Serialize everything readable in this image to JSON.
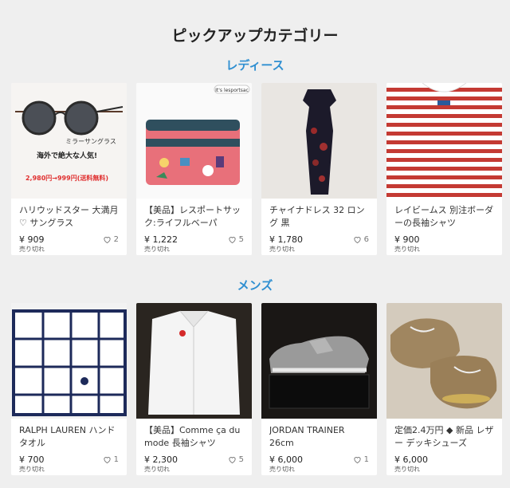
{
  "page_title": "ピックアップカテゴリー",
  "sections": [
    {
      "heading": "レディース",
      "items": [
        {
          "title": "ハリウッドスター 大満月 ♡ サングラス",
          "price": "¥ 909",
          "sold": "売り切れ",
          "likes": "2",
          "image_text_1": "ミラーサングラス",
          "image_text_2": "海外で絶大な人気!",
          "image_text_3": "2,980円→999円(送料無料)"
        },
        {
          "title": "【美品】レスポートサック:ライフルベーパ",
          "price": "¥ 1,222",
          "sold": "売り切れ",
          "likes": "5",
          "image_text_1": "It's lesportsac"
        },
        {
          "title": "チャイナドレス 32 ロング 黒",
          "price": "¥ 1,780",
          "sold": "売り切れ",
          "likes": "6"
        },
        {
          "title": "レイビームス 別注ボーダーの長袖シャツ",
          "price": "¥ 900",
          "sold": "売り切れ",
          "likes": ""
        }
      ]
    },
    {
      "heading": "メンズ",
      "items": [
        {
          "title": "RALPH LAUREN ハンドタオル",
          "price": "¥ 700",
          "sold": "売り切れ",
          "likes": "1"
        },
        {
          "title": "【美品】Comme ça du mode 長袖シャツ",
          "price": "¥ 2,300",
          "sold": "売り切れ",
          "likes": "5"
        },
        {
          "title": "JORDAN TRAINER 26cm",
          "price": "¥ 6,000",
          "sold": "売り切れ",
          "likes": "1"
        },
        {
          "title": "定価2.4万円 ◆ 新品 レザー デッキシューズ",
          "price": "¥ 6,000",
          "sold": "売り切れ",
          "likes": ""
        }
      ]
    }
  ],
  "colors": {
    "accent": "#2f8fd1",
    "background": "#efefef",
    "card": "#ffffff"
  }
}
